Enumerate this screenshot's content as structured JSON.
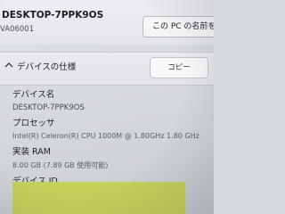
{
  "header": {
    "device_name": "DESKTOP-7PPK9OS",
    "device_model": "VA06001",
    "rename_button_label": "この PC の名前を変更"
  },
  "device_specs": {
    "section_title": "デバイスの仕様",
    "copy_button_label": "コピー",
    "chevron_icon": "chevron-up-icon",
    "fields": [
      {
        "label": "デバイス名",
        "value": "DESKTOP-7PPK9OS"
      },
      {
        "label": "プロセッサ",
        "value": "Intel(R) Celeron(R) CPU 1000M @ 1.80GHz   1.80 GHz"
      },
      {
        "label": "実装 RAM",
        "value": "8.00 GB (7.89 GB 使用可能)"
      },
      {
        "label": "デバイス ID",
        "value": ""
      }
    ]
  },
  "colors": {
    "redaction": "#c8d15a"
  }
}
